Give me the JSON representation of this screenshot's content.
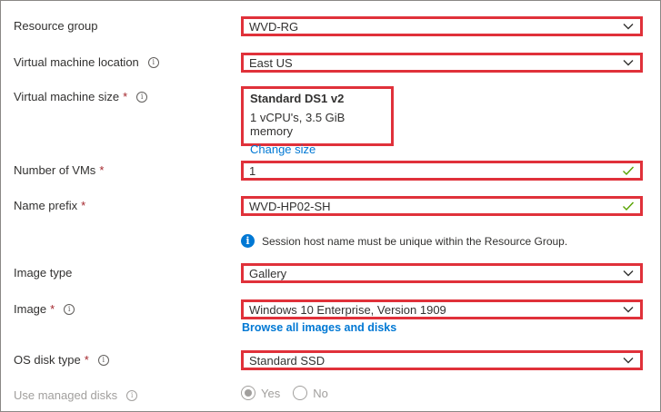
{
  "form": {
    "resource_group": {
      "label": "Resource group",
      "value": "WVD-RG"
    },
    "vm_location": {
      "label": "Virtual machine location",
      "value": "East US"
    },
    "vm_size": {
      "label": "Virtual machine size",
      "required_mark": "*",
      "size_name": "Standard DS1 v2",
      "size_desc": "1 vCPU's, 3.5 GiB memory",
      "change_link": "Change size"
    },
    "num_vms": {
      "label": "Number of VMs",
      "required_mark": "*",
      "value": "1"
    },
    "name_prefix": {
      "label": "Name prefix",
      "required_mark": "*",
      "value": "WVD-HP02-SH"
    },
    "notice": "Session host name must be unique within the Resource Group.",
    "image_type": {
      "label": "Image type",
      "value": "Gallery"
    },
    "image": {
      "label": "Image",
      "required_mark": "*",
      "value": "Windows 10 Enterprise, Version 1909",
      "browse_link": "Browse all images and disks"
    },
    "os_disk": {
      "label": "OS disk type",
      "required_mark": "*",
      "value": "Standard SSD"
    },
    "managed_disks": {
      "label": "Use managed disks",
      "options": [
        "Yes",
        "No"
      ],
      "selected": "Yes"
    }
  },
  "icons": {
    "info": "info-icon",
    "chevron": "chevron-down-icon",
    "check": "checkmark-icon",
    "notice": "info-filled-icon"
  },
  "colors": {
    "highlight": "#e0313a",
    "link": "#0078d4",
    "required": "#a4262c",
    "valid": "#57a300"
  }
}
